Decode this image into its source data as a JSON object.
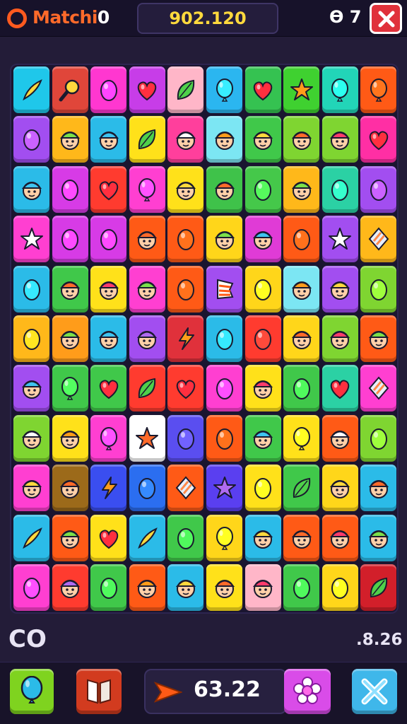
{
  "header": {
    "app_title_text": "Matchi",
    "app_title_digit": "0",
    "score": "902.120",
    "right_info": "Ө 7"
  },
  "status": {
    "left_text": "CO",
    "right_text": ".8.26"
  },
  "footer": {
    "timer_value": "63.22"
  },
  "board": {
    "rows": 11,
    "cols": 10,
    "tiles": [
      [
        "#1fc7ea:feather",
        "#e0463a:magnifier",
        "#ff37d0:egg",
        "#c73de8:heart",
        "#ffb6c8:leaf",
        "#2bb6f0:balloon",
        "#35c251:heart",
        "#3fd130:star",
        "#22d5b8:balloon",
        "#ff5a16:balloon"
      ],
      [
        "#a24ef0:egg",
        "#ffb81a:face",
        "#2bbbe8:face",
        "#ffe11a:leaf",
        "#ff3f9c:face",
        "#7ce6f3:face",
        "#40c84a:face",
        "#7fd531:face",
        "#7fd531:face",
        "#ff2fa4:heart"
      ],
      [
        "#2bbbe8:face",
        "#d73be6:egg",
        "#ff3b2f:heart",
        "#ff3fd1:balloon",
        "#ffe11a:face",
        "#3fc24a:face",
        "#45c84a:egg",
        "#ffb81a:face",
        "#2bd1a4:egg",
        "#a24ef0:egg"
      ],
      [
        "#ff3fd1:star",
        "#d73be6:egg",
        "#d73be6:egg",
        "#ff5a16:face",
        "#ff5a16:egg",
        "#ffd61a:face",
        "#e03bd6:face",
        "#ff5a16:egg",
        "#a24ef0:star",
        "#ffb81a:diamond"
      ],
      [
        "#2bbbe8:egg",
        "#40c84a:face",
        "#ffe11a:face",
        "#ff3fd1:face",
        "#ff5a16:egg",
        "#a24ef0:flag",
        "#ffd61a:egg",
        "#7ce6f3:face",
        "#a24ef0:face",
        "#7fd531:egg"
      ],
      [
        "#ffb81a:egg",
        "#ff9c1a:face",
        "#2bbbe8:face",
        "#a24ef0:face",
        "#e0313b:flame",
        "#2bbbe8:egg",
        "#ff3b2f:egg",
        "#ffd61a:face",
        "#7fd531:face",
        "#ff5a16:face"
      ],
      [
        "#a24ef0:face",
        "#40c84a:balloon",
        "#40c84a:heart",
        "#ff3b2f:leaf",
        "#ff3b2f:heart",
        "#ff3fd1:egg",
        "#ffe11a:face",
        "#40c84a:egg",
        "#2bd1a4:heart",
        "#ff3fd1:diamond"
      ],
      [
        "#7fd531:face",
        "#ffe11a:face",
        "#ff3fd1:balloon",
        "#ffffff:star",
        "#5a4ef0:egg",
        "#ff5a16:egg",
        "#40c84a:face",
        "#ffe11a:balloon",
        "#ff5a16:face",
        "#7fd531:egg"
      ],
      [
        "#ff3fd1:face",
        "#9c6a1a:face",
        "#3a4ef0:flame",
        "#2b6ef0:egg",
        "#ff5a16:diamond",
        "#5a3ff0:star",
        "#ffe11a:egg",
        "#40c84a:leaf",
        "#ffd61a:face",
        "#2bbbe8:face"
      ],
      [
        "#2bbbe8:feather",
        "#ff5a16:face",
        "#ffe11a:heart",
        "#2bbbe8:feather",
        "#40c84a:egg",
        "#ffd61a:balloon",
        "#2bbbe8:face",
        "#ff5a16:face",
        "#ff5a16:face",
        "#2bbbe8:face"
      ],
      [
        "#ff3fd1:egg",
        "#ff3b2f:face",
        "#40c84a:egg",
        "#ff5a16:face",
        "#2bbbe8:face",
        "#ffe11a:face",
        "#ffb6c8:face",
        "#40c84a:egg",
        "#ffd61a:egg",
        "#d21f2a:leaf"
      ]
    ]
  }
}
